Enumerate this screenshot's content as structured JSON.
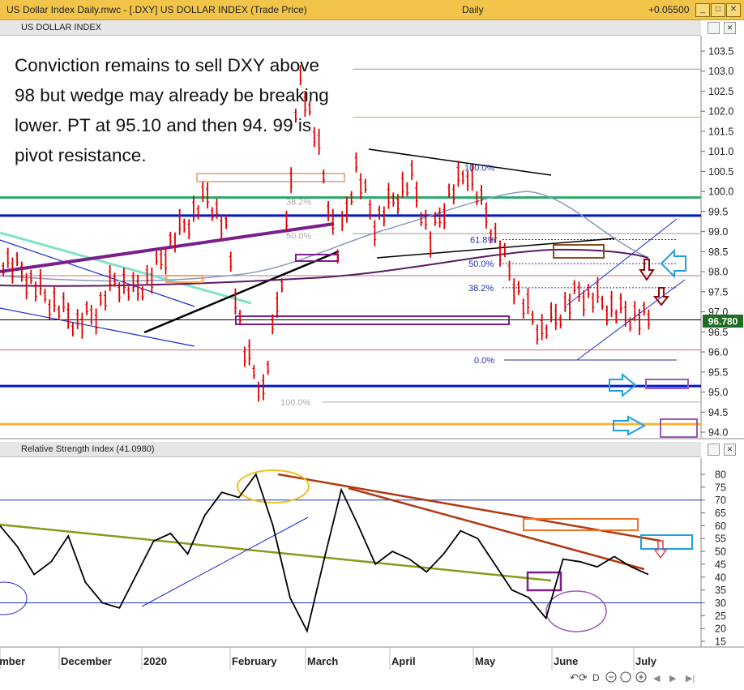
{
  "window": {
    "title": "US Dollar Index Daily.mwc - [.DXY] US DOLLAR INDEX (Trade Price)",
    "interval": "Daily",
    "change": "+0.05500",
    "minimize": "_",
    "restore": "□",
    "close": "✕"
  },
  "price_panel": {
    "title": "US DOLLAR INDEX",
    "last_price": "96.780"
  },
  "rsi_panel": {
    "title": "Relative Strength Index",
    "value": "(41.0980)"
  },
  "annotation": "Conviction remains to sell DXY above 98 but wedge may already be breaking lower. PT at 95.10 and then 94. 99 is pivot resistance.",
  "colors": {
    "title_bar": "#f2c54a",
    "candles": "#e00000",
    "horizontal_support": "#0018c8",
    "pivot": "#2aa86b",
    "target": "#f7b531",
    "rsi_line": "#000000"
  },
  "chart_data": [
    {
      "type": "candlestick",
      "title": "US DOLLAR INDEX",
      "ylim": [
        93.9,
        103.6
      ],
      "y_ticks": [
        "103.5",
        "103.0",
        "102.5",
        "102.0",
        "101.5",
        "101.0",
        "100.5",
        "100.0",
        "99.5",
        "99.0",
        "98.5",
        "98.0",
        "97.5",
        "97.0",
        "96.5",
        "96.0",
        "95.5",
        "95.0",
        "94.5",
        "94.0"
      ],
      "x_labels": [
        "ember",
        "December",
        "2020",
        "February",
        "March",
        "April",
        "May",
        "June",
        "July"
      ],
      "fib_left": [
        {
          "label": "100.0%",
          "value": 94.75
        },
        {
          "label": "50.0%",
          "value": 98.9
        },
        {
          "label": "38.2%",
          "value": 99.75
        }
      ],
      "fib_right": [
        {
          "label": "100.0%",
          "value": 100.6
        },
        {
          "label": "61.8%",
          "value": 98.8
        },
        {
          "label": "50.0%",
          "value": 98.2
        },
        {
          "label": "38.2%",
          "value": 97.6
        },
        {
          "label": "0.0%",
          "value": 95.8
        }
      ],
      "horizontal_levels": [
        {
          "value": 99.85,
          "color": "#2aa86b"
        },
        {
          "value": 99.4,
          "color": "#0018c8"
        },
        {
          "value": 95.15,
          "color": "#0018c8"
        },
        {
          "value": 94.2,
          "color": "#f7b531"
        },
        {
          "value": 103.05,
          "color": "#9a9a9a"
        },
        {
          "value": 101.85,
          "color": "#d4a04a"
        },
        {
          "value": 98.95,
          "color": "#9a9a9a"
        },
        {
          "value": 97.9,
          "color": "#c07070"
        },
        {
          "value": 96.8,
          "color": "#000000"
        },
        {
          "value": 96.05,
          "color": "#c07070"
        }
      ],
      "series": [
        {
          "name": "",
          "x": [
            0,
            6,
            12,
            18,
            24,
            30,
            36,
            42,
            48,
            54,
            60,
            66,
            72,
            78,
            84,
            90,
            96,
            102,
            108,
            114,
            120,
            126,
            132,
            138,
            144,
            150,
            156,
            162,
            168,
            174,
            180,
            186,
            192,
            198,
            204,
            210
          ],
          "close": [
            98.3,
            98.0,
            97.5,
            97.1,
            96.7,
            97.0,
            97.8,
            97.5,
            97.9,
            98.7,
            99.3,
            99.9,
            99.0,
            96.0,
            95.0,
            97.9,
            102.9,
            101.0,
            98.5,
            100.6,
            99.2,
            99.8,
            100.3,
            98.8,
            99.9,
            100.5,
            99.4,
            98.3,
            97.2,
            96.5,
            97.0,
            97.5,
            97.3,
            97.0,
            96.9,
            96.78
          ]
        }
      ]
    },
    {
      "type": "line",
      "title": "Relative Strength Index",
      "ylim": [
        15,
        85
      ],
      "y_ticks": [
        "80",
        "75",
        "70",
        "65",
        "60",
        "55",
        "50",
        "45",
        "40",
        "35",
        "30",
        "25",
        "20",
        "15"
      ],
      "series": [
        {
          "name": "",
          "values": [
            60,
            52,
            41,
            46,
            56,
            38,
            30,
            28,
            41,
            54,
            57,
            49,
            64,
            73,
            71,
            80,
            60,
            32,
            19,
            47,
            74,
            60,
            45,
            50,
            47,
            42,
            49,
            58,
            55,
            45,
            35,
            32,
            24,
            47,
            46,
            44,
            48,
            44,
            41
          ]
        }
      ]
    }
  ]
}
